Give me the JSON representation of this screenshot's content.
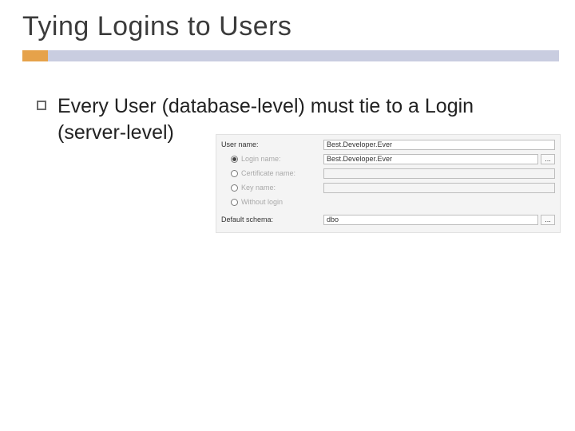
{
  "title": "Tying Logins to Users",
  "bullet": "Every User (database-level) must tie to a Login (server-level)",
  "form": {
    "username_label": "User name:",
    "username_value": "Best.Developer.Ever",
    "options": {
      "login": {
        "label": "Login name:",
        "value": "Best.Developer.Ever",
        "selected": true
      },
      "certificate": {
        "label": "Certificate name:",
        "value": "",
        "selected": false
      },
      "key": {
        "label": "Key name:",
        "value": "",
        "selected": false
      },
      "without": {
        "label": "Without login",
        "selected": false
      }
    },
    "schema_label": "Default schema:",
    "schema_value": "dbo",
    "ellipsis": "..."
  }
}
